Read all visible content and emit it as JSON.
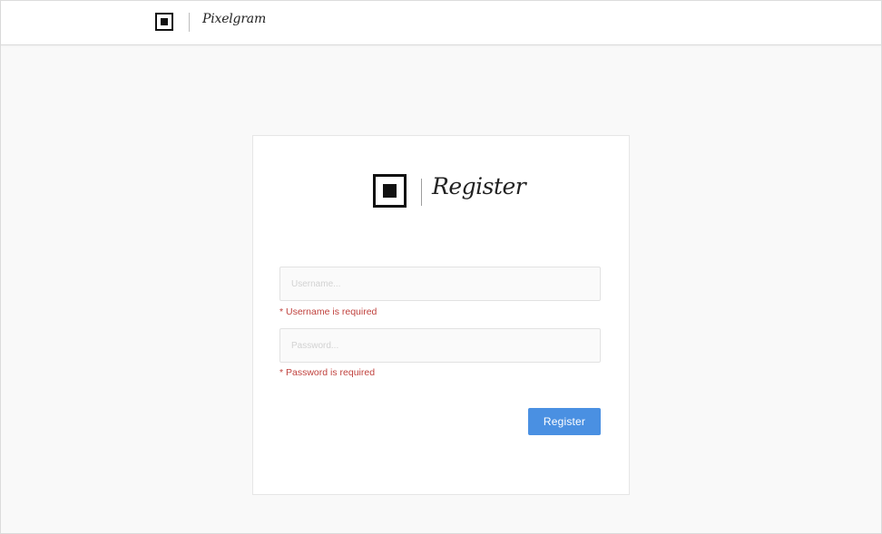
{
  "header": {
    "logo_icon": "square-logo-icon",
    "brand_name": "Pixelgram"
  },
  "register_card": {
    "logo_icon": "square-logo-icon",
    "title": "Register",
    "username": {
      "placeholder": "Username...",
      "value": "",
      "error": "* Username is required"
    },
    "password": {
      "placeholder": "Password...",
      "value": "",
      "error": "* Password is required"
    },
    "submit_label": "Register"
  },
  "colors": {
    "page_background": "#f9f9f9",
    "accent": "#4a90e2",
    "error": "#c0423e",
    "text": "#222222"
  }
}
